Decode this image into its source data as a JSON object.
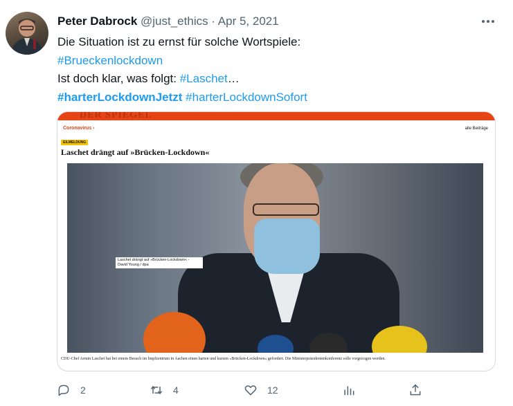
{
  "tweet": {
    "author": {
      "name": "Peter Dabrock",
      "handle": "@just_ethics",
      "separator": "·",
      "date": "Apr 5, 2021"
    },
    "text": {
      "line1": "Die Situation ist zu ernst für solche Wortspiele:",
      "hashtag_brueckenlockdown": "#Brueckenlockdown",
      "line3_prefix": "Ist doch klar, was folgt: ",
      "hashtag_laschet": "#Laschet",
      "ellipsis": "…",
      "hashtag_harterlockdownjetzt": "#harterLockdownJetzt",
      "hashtag_harterlockdownsofort": "#harterLockdownSofort"
    },
    "media": {
      "brand": "DER SPIEGEL",
      "breadcrumb": "Coronavirus ›",
      "all_posts": "alle Beiträge",
      "badge": "EILMELDUNG",
      "headline": "Laschet drängt auf »Brücken-Lockdown«",
      "photo_label_line1": "Laschet drängt auf »Brücken-Lockdown« -",
      "photo_label_line2": "David Young / dpa",
      "caption": "CDU-Chef Armin Laschet hat bei einem Besuch im Impfzentrum in Aachen einen harten und kurzen »Brücken-Lockdown« gefordert. Die Ministerpräsidentenkonferenz solle vorgezogen werden."
    },
    "actions": {
      "reply_count": "2",
      "retweet_count": "4",
      "like_count": "12",
      "views_count": "",
      "icons": [
        "reply-icon",
        "retweet-icon",
        "like-icon",
        "views-icon",
        "share-icon"
      ]
    }
  },
  "colors": {
    "text": "#0f1419",
    "muted": "#536471",
    "link": "#1d9bf0",
    "spiegel_red": "#e64415",
    "badge_yellow": "#f5c400"
  }
}
